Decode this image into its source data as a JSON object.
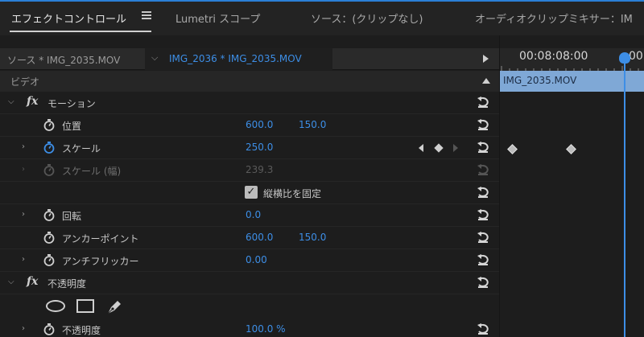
{
  "tabs": [
    {
      "label": "エフェクトコントロール"
    },
    {
      "label": "Lumetri スコープ"
    },
    {
      "label": "ソース：(クリップなし)"
    },
    {
      "label": "オーディオクリップミキサー：IM"
    }
  ],
  "clip_bar": {
    "source_label": "ソース * IMG_2035.MOV",
    "sequence_label": "IMG_2036 * IMG_2035.MOV"
  },
  "section": {
    "label": "ビデオ"
  },
  "motion": {
    "label": "モーション",
    "position": {
      "label": "位置",
      "x": "600.0",
      "y": "150.0"
    },
    "scale": {
      "label": "スケール",
      "value": "250.0"
    },
    "scale_width": {
      "label": "スケール (幅)",
      "value": "239.3"
    },
    "uniform_scale": {
      "label": "縦横比を固定",
      "checked": true
    },
    "rotation": {
      "label": "回転",
      "value": "0.0"
    },
    "anchor": {
      "label": "アンカーポイント",
      "x": "600.0",
      "y": "150.0"
    },
    "flicker": {
      "label": "アンチフリッカー",
      "value": "0.00"
    }
  },
  "opacity": {
    "label": "不透明度",
    "opacity_param": {
      "label": "不透明度",
      "value": "100.0 %"
    }
  },
  "timeline": {
    "timecode": "00:08:08:00",
    "timecode_cut": "00:",
    "clip_name": "IMG_2035.MOV"
  }
}
